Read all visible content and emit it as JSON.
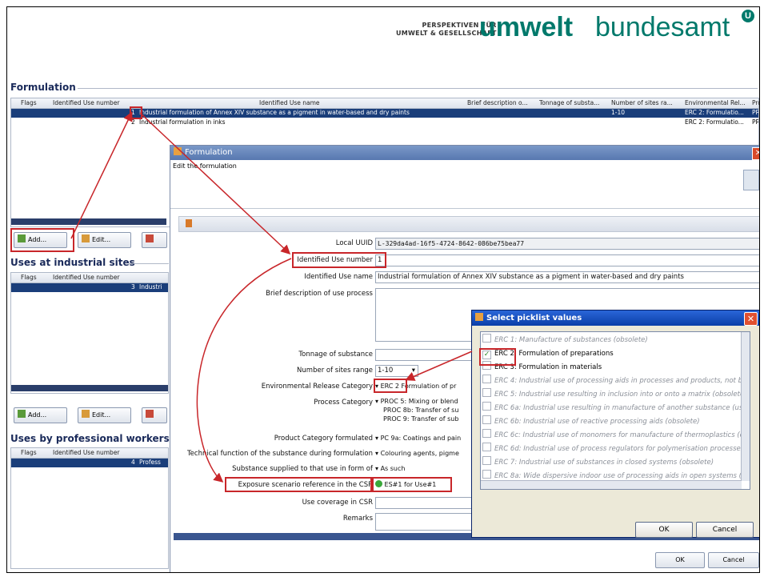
{
  "logo": {
    "small_line1": "PERSPEKTIVEN FÜR",
    "small_line2": "UMWELT & GESELLSCHAFT",
    "umwelt": "umwelt",
    "bundesamt": "bundesamt",
    "mark": "U"
  },
  "formulation": {
    "title": "Formulation",
    "columns": [
      "Flags",
      "Identified Use number",
      "Identified Use name",
      "Brief description o...",
      "Tonnage of substa...",
      "Number of sites ra...",
      "Environmental Rel...",
      "Pro"
    ],
    "rows": [
      {
        "number": "1",
        "name": "Industrial formulation of Annex XIV substance as a pigment in water-based and dry paints",
        "sites": "1-10",
        "erc": "ERC 2: Formulatio...",
        "pro": "PRO"
      },
      {
        "number": "2",
        "name": "Industrial formulation in inks",
        "sites": "",
        "erc": "ERC 2: Formulatio...",
        "pro": "PRO"
      }
    ],
    "add_label": "Add...",
    "edit_label": "Edit..."
  },
  "industrial": {
    "title": "Uses at industrial sites",
    "columns": [
      "Flags",
      "Identified Use number"
    ],
    "row_number": "3",
    "row_name": "Industri",
    "add_label": "Add...",
    "edit_label": "Edit..."
  },
  "professional": {
    "title": "Uses by professional workers",
    "columns": [
      "Flags",
      "Identified Use number"
    ],
    "row_number": "4",
    "row_name": "Profess"
  },
  "dialog": {
    "title": "Formulation",
    "subtitle": "Edit the formulation",
    "fields": {
      "local_uuid_label": "Local UUID",
      "local_uuid_value": "L-329da4ad-16f5-4724-8642-086be75bea77",
      "use_number_label": "Identified Use number",
      "use_number_value": "1",
      "use_name_label": "Identified Use name",
      "use_name_value": "Industrial formulation of Annex XIV substance as a pigment in water-based and dry paints",
      "brief_label": "Brief description of use process",
      "tonnage_label": "Tonnage of substance",
      "sites_label": "Number of sites range",
      "sites_value": "1-10",
      "erc_label": "Environmental Release Category",
      "erc_value": "ERC 2",
      "erc_rest": "Formulation of pr",
      "proc_label": "Process Category",
      "proc_values": [
        "PROC 5: Mixing or blend",
        "PROC 8b: Transfer of su",
        "PROC 9: Transfer of sub"
      ],
      "pc_label": "Product Category formulated",
      "pc_value": "PC 9a: Coatings and pain",
      "tech_label": "Technical function of the substance during formulation",
      "tech_value": "Colouring agents, pigme",
      "supplied_label": "Substance supplied to that use in form of",
      "supplied_value": "As such",
      "es_label": "Exposure scenario reference in the CSR",
      "es_value": "ES#1 for Use#1",
      "coverage_label": "Use coverage in CSR",
      "remarks_label": "Remarks"
    },
    "ok_label": "OK",
    "cancel_label": "Cancel"
  },
  "picklist": {
    "title": "Select picklist values",
    "items": [
      {
        "label": "ERC 1: Manufacture of substances (obsolete)",
        "checked": false,
        "disabled": true
      },
      {
        "label": "ERC 2: Formulation of preparations",
        "checked": true,
        "disabled": false
      },
      {
        "label": "ERC 3: Formulation in materials",
        "checked": false,
        "disabled": false
      },
      {
        "label": "ERC 4: Industrial use of processing aids in processes and products, not be",
        "checked": false,
        "disabled": true
      },
      {
        "label": "ERC 5: Industrial use resulting in inclusion into or onto a matrix (obsolete)",
        "checked": false,
        "disabled": true
      },
      {
        "label": "ERC 6a: Industrial use resulting in manufacture of another substance (use",
        "checked": false,
        "disabled": true
      },
      {
        "label": "ERC 6b: Industrial use of reactive processing aids (obsolete)",
        "checked": false,
        "disabled": true
      },
      {
        "label": "ERC 6c: Industrial use of monomers for manufacture of thermoplastics (ol",
        "checked": false,
        "disabled": true
      },
      {
        "label": "ERC 6d: Industrial use of process regulators for polymerisation processes",
        "checked": false,
        "disabled": true
      },
      {
        "label": "ERC 7: Industrial use of substances in closed systems (obsolete)",
        "checked": false,
        "disabled": true
      },
      {
        "label": "ERC 8a: Wide dispersive indoor use of processing aids in open systems (o",
        "checked": false,
        "disabled": true
      }
    ],
    "ok_label": "OK",
    "cancel_label": "Cancel"
  },
  "colors": {
    "selection": "#1a3e7a",
    "highlight_box": "#c8262a",
    "brand": "#00796b"
  }
}
